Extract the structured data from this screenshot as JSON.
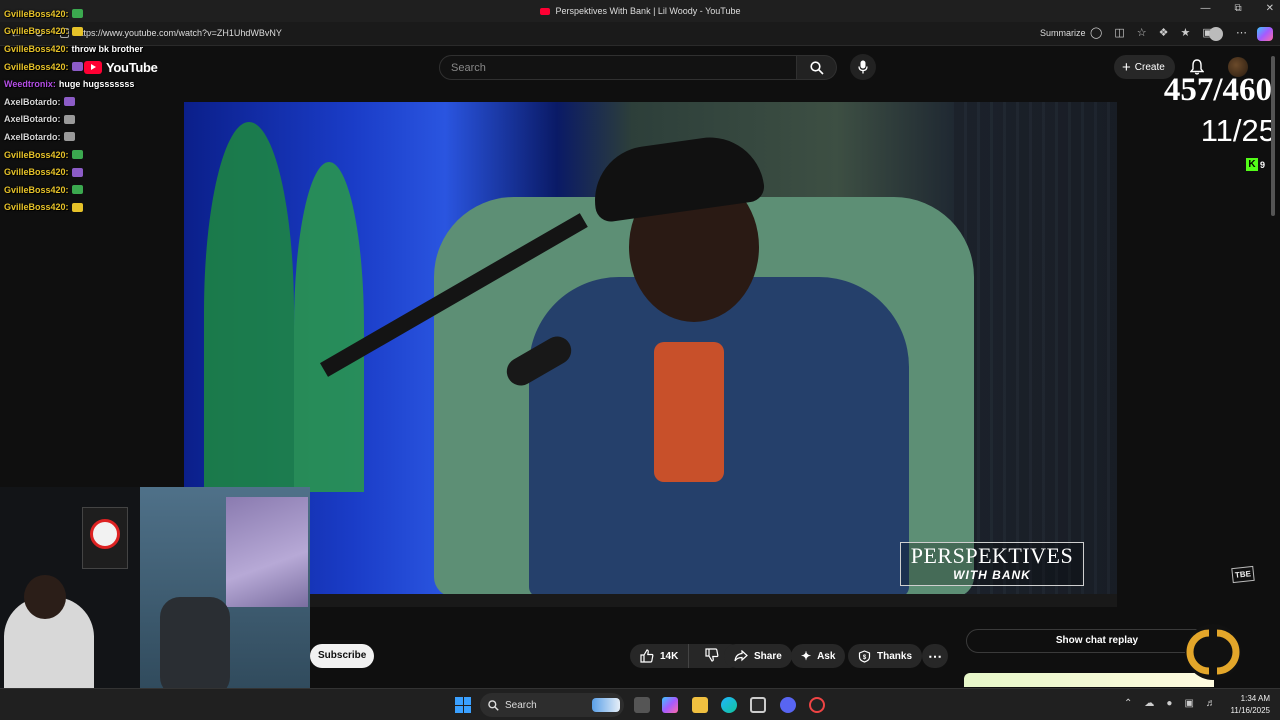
{
  "browser": {
    "title": "Perspektives With Bank | Lil Woody - YouTube",
    "url": "https://www.youtube.com/watch?v=ZH1UhdWBvNY",
    "summarize_label": "Summarize"
  },
  "youtube": {
    "logo_text": "YouTube",
    "search_placeholder": "Search",
    "create_label": "Create"
  },
  "video": {
    "brand_line1": "PERSPEKTIVES",
    "brand_line2": "WITH BANK",
    "tbe_logo": "TBE"
  },
  "actions": {
    "subscribe_label": "Subscribe",
    "like_count": "14K",
    "share_label": "Share",
    "ask_label": "Ask",
    "thanks_label": "Thanks",
    "chat_replay_label": "Show chat replay"
  },
  "overlay": {
    "counter_big": "457/460",
    "counter_small": "11/25",
    "kick_viewers": "9",
    "chat": [
      {
        "user": "GvilleBoss420:",
        "message": "",
        "user_color": "#e6c229",
        "emote_color": "#3ba94f"
      },
      {
        "user": "GvilleBoss420:",
        "message": "",
        "user_color": "#e6c229",
        "emote_color": "#e6c229"
      },
      {
        "user": "GvilleBoss420:",
        "message": "throw bk brother",
        "user_color": "#e6c229",
        "emote_color": ""
      },
      {
        "user": "GvilleBoss420:",
        "message": "",
        "user_color": "#e6c229",
        "emote_color": "#8c5cc7"
      },
      {
        "user": "Weedtronix:",
        "message": "huge hugsssssss",
        "user_color": "#b44ee6",
        "emote_color": ""
      },
      {
        "user": "AxelBotardo:",
        "message": "",
        "user_color": "#d6d6d6",
        "emote_color": "#8c5cc7"
      },
      {
        "user": "AxelBotardo:",
        "message": "",
        "user_color": "#d6d6d6",
        "emote_color": "#9a9a9a"
      },
      {
        "user": "AxelBotardo:",
        "message": "",
        "user_color": "#d6d6d6",
        "emote_color": "#9a9a9a"
      },
      {
        "user": "GvilleBoss420:",
        "message": "",
        "user_color": "#e6c229",
        "emote_color": "#3ba94f"
      },
      {
        "user": "GvilleBoss420:",
        "message": "",
        "user_color": "#e6c229",
        "emote_color": "#8c5cc7"
      },
      {
        "user": "GvilleBoss420:",
        "message": "",
        "user_color": "#e6c229",
        "emote_color": "#3ba94f"
      },
      {
        "user": "GvilleBoss420:",
        "message": "",
        "user_color": "#e6c229",
        "emote_color": "#e6c229"
      }
    ]
  },
  "taskbar": {
    "search_label": "Search",
    "time": "1:34 AM",
    "date": "11/16/2025"
  },
  "colors": {
    "accent": "#ff0033",
    "kick_green": "#53fc18"
  }
}
